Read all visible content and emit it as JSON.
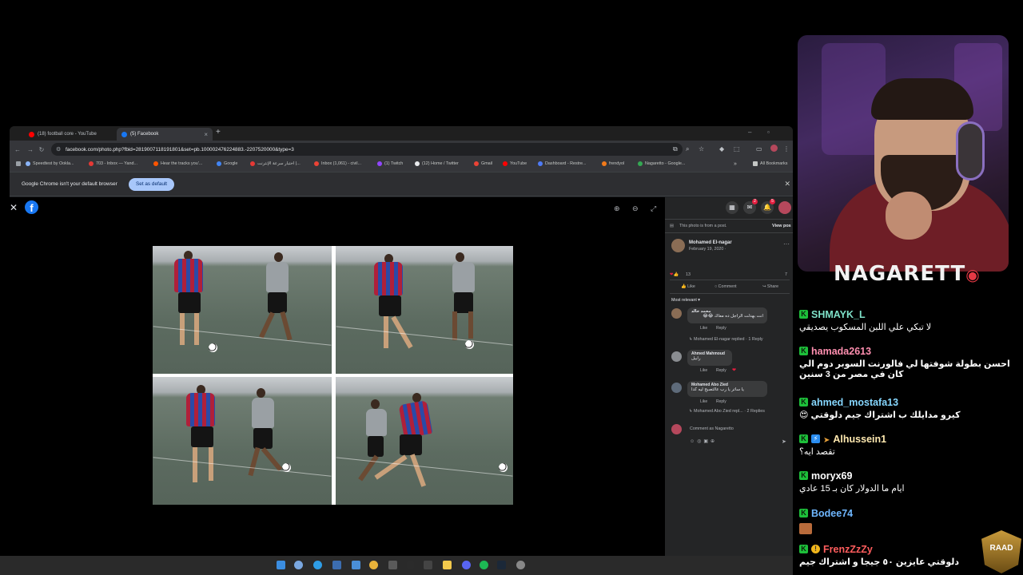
{
  "browser": {
    "tabs": [
      {
        "label": "(18) football core - YouTube",
        "favicon_color": "#ff0000"
      },
      {
        "label": "(5) Facebook",
        "favicon_color": "#1877f2"
      }
    ],
    "url": "facebook.com/photo.php?fbid=2819007118191801&set=pb.100002476224883.-2207520000&type=3",
    "bookmarks": [
      {
        "label": "Speedtest by Ookla...",
        "color": "#8ab4f8"
      },
      {
        "label": "703 - Inbox — Yand...",
        "color": "#e53935"
      },
      {
        "label": "Hear the tracks you'...",
        "color": "#ff5500"
      },
      {
        "label": "Google",
        "color": "#4285f4"
      },
      {
        "label": "اختبار سرعة الإنترنت |...",
        "color": "#e53935"
      },
      {
        "label": "Inbox (1,061) - civil...",
        "color": "#ea4335"
      },
      {
        "label": "(1) Twitch",
        "color": "#9146ff"
      },
      {
        "label": "(12) Home / Twitter",
        "color": "#e8eaed"
      },
      {
        "label": "Gmail",
        "color": "#ea4335"
      },
      {
        "label": "YouTube",
        "color": "#ff0000"
      },
      {
        "label": "Dashboard - Restre...",
        "color": "#4e7bf6"
      },
      {
        "label": "frendyol",
        "color": "#f27a1a"
      },
      {
        "label": "Nagaretto - Google...",
        "color": "#34a853"
      },
      {
        "label": "All Bookmarks",
        "color": "#c4c7c5"
      }
    ],
    "infobar_text": "Google Chrome isn't your default browser",
    "set_default_label": "Set as default"
  },
  "facebook": {
    "post_notice": "This photo is from a post.",
    "view_post": "View pos",
    "author": "Mohamed El-nagar",
    "date": "February 19, 2020 · ",
    "reactions_count": "13",
    "comments_count": "7",
    "actions": {
      "like": "Like",
      "comment": "Comment",
      "share": "Share"
    },
    "sort_label": "Most relevant",
    "notif_badge_messages": "2",
    "notif_badge_bell": "5",
    "comments": [
      {
        "name": "محمد خالد",
        "text": "انت بهدلت الراجل ده معاك 😂😂",
        "like": "Like",
        "reply": "Reply",
        "replies": "Mohamed El-nagar replied · 1 Reply"
      },
      {
        "name": "Ahmed Mahmoud",
        "text": "رابيل",
        "like": "Like",
        "reply": "Reply"
      },
      {
        "name": "Mohamed Abo Zied",
        "text": "يا ساتر يا رب عالتصبح ليه كدا",
        "like": "Like",
        "reply": "Reply",
        "replies": "Mohamed Abo Zied repl... · 2 Replies"
      }
    ],
    "comment_placeholder": "Comment as Nagaretto"
  },
  "stream": {
    "streamer": "NAGARETT",
    "logo_text": "RAAD",
    "chat": [
      {
        "user": "SHMAYK_L",
        "text": "لا تبكي علي اللبن المسكوب يصديقي"
      },
      {
        "user": "hamada2613",
        "text": "احسن بطولة شوفتها لي فالورنت السوبر دوم الي كان في مصر من 3 سنين"
      },
      {
        "user": "ahmed_mostafa13",
        "text": "كيرو مدايلك ب اشتراك جيم دلوقتي 😍"
      },
      {
        "user": "Alhussein1",
        "text": "تقصد ايه؟"
      },
      {
        "user": "moryx69",
        "text": "ايام ما الدولار كان بـ 15 عادي"
      },
      {
        "user": "Bodee74",
        "text": ""
      },
      {
        "user": "FrenzZzZy",
        "text": "دلوقتي عايزين ٥٠ جيجا و اشتراك جيم"
      }
    ]
  }
}
